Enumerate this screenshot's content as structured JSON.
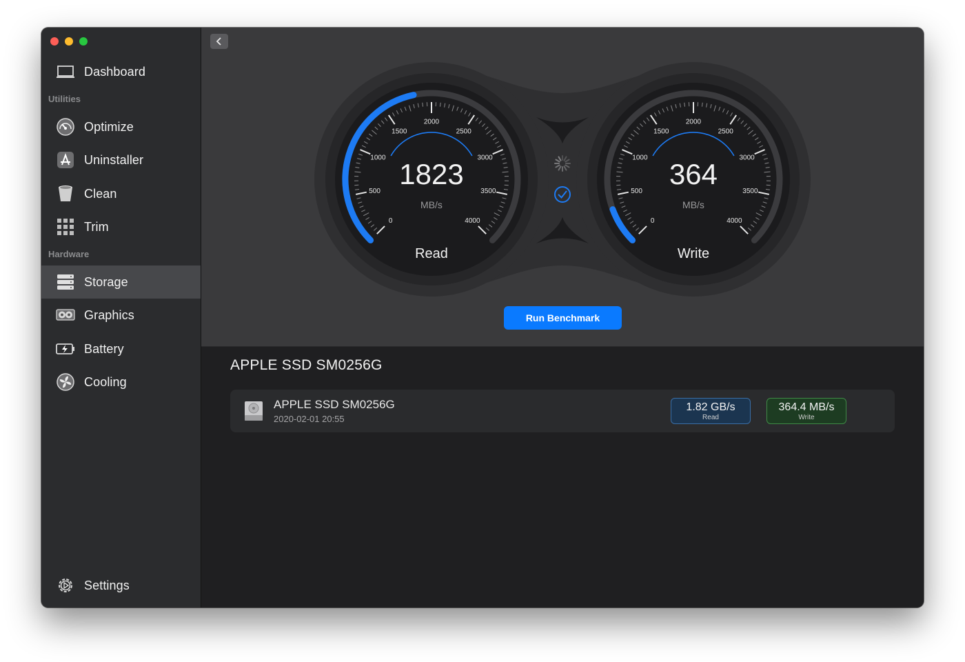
{
  "sidebar": {
    "dashboard": "Dashboard",
    "utilities_label": "Utilities",
    "items_utilities": [
      "Optimize",
      "Uninstaller",
      "Clean",
      "Trim"
    ],
    "hardware_label": "Hardware",
    "items_hardware": [
      "Storage",
      "Graphics",
      "Battery",
      "Cooling"
    ],
    "active": "Storage",
    "settings": "Settings"
  },
  "gauges": {
    "read": {
      "value": "1823",
      "unit": "MB/s",
      "label": "Read",
      "numeric": 1823
    },
    "write": {
      "value": "364",
      "unit": "MB/s",
      "label": "Write",
      "numeric": 364
    },
    "scale_max": 4000,
    "ticks": [
      "0",
      "500",
      "1000",
      "1500",
      "2000",
      "2500",
      "3000",
      "3500",
      "4000"
    ],
    "accent": "#1d7bf4"
  },
  "run_button": "Run Benchmark",
  "disk": {
    "title": "APPLE SSD SM0256G",
    "name": "APPLE SSD SM0256G",
    "date": "2020-02-01 20:55",
    "read_value": "1.82 GB/s",
    "read_label": "Read",
    "write_value": "364.4 MB/s",
    "write_label": "Write"
  },
  "colors": {
    "read_badge": "#3a6ea6",
    "write_badge": "#3f8a46"
  }
}
